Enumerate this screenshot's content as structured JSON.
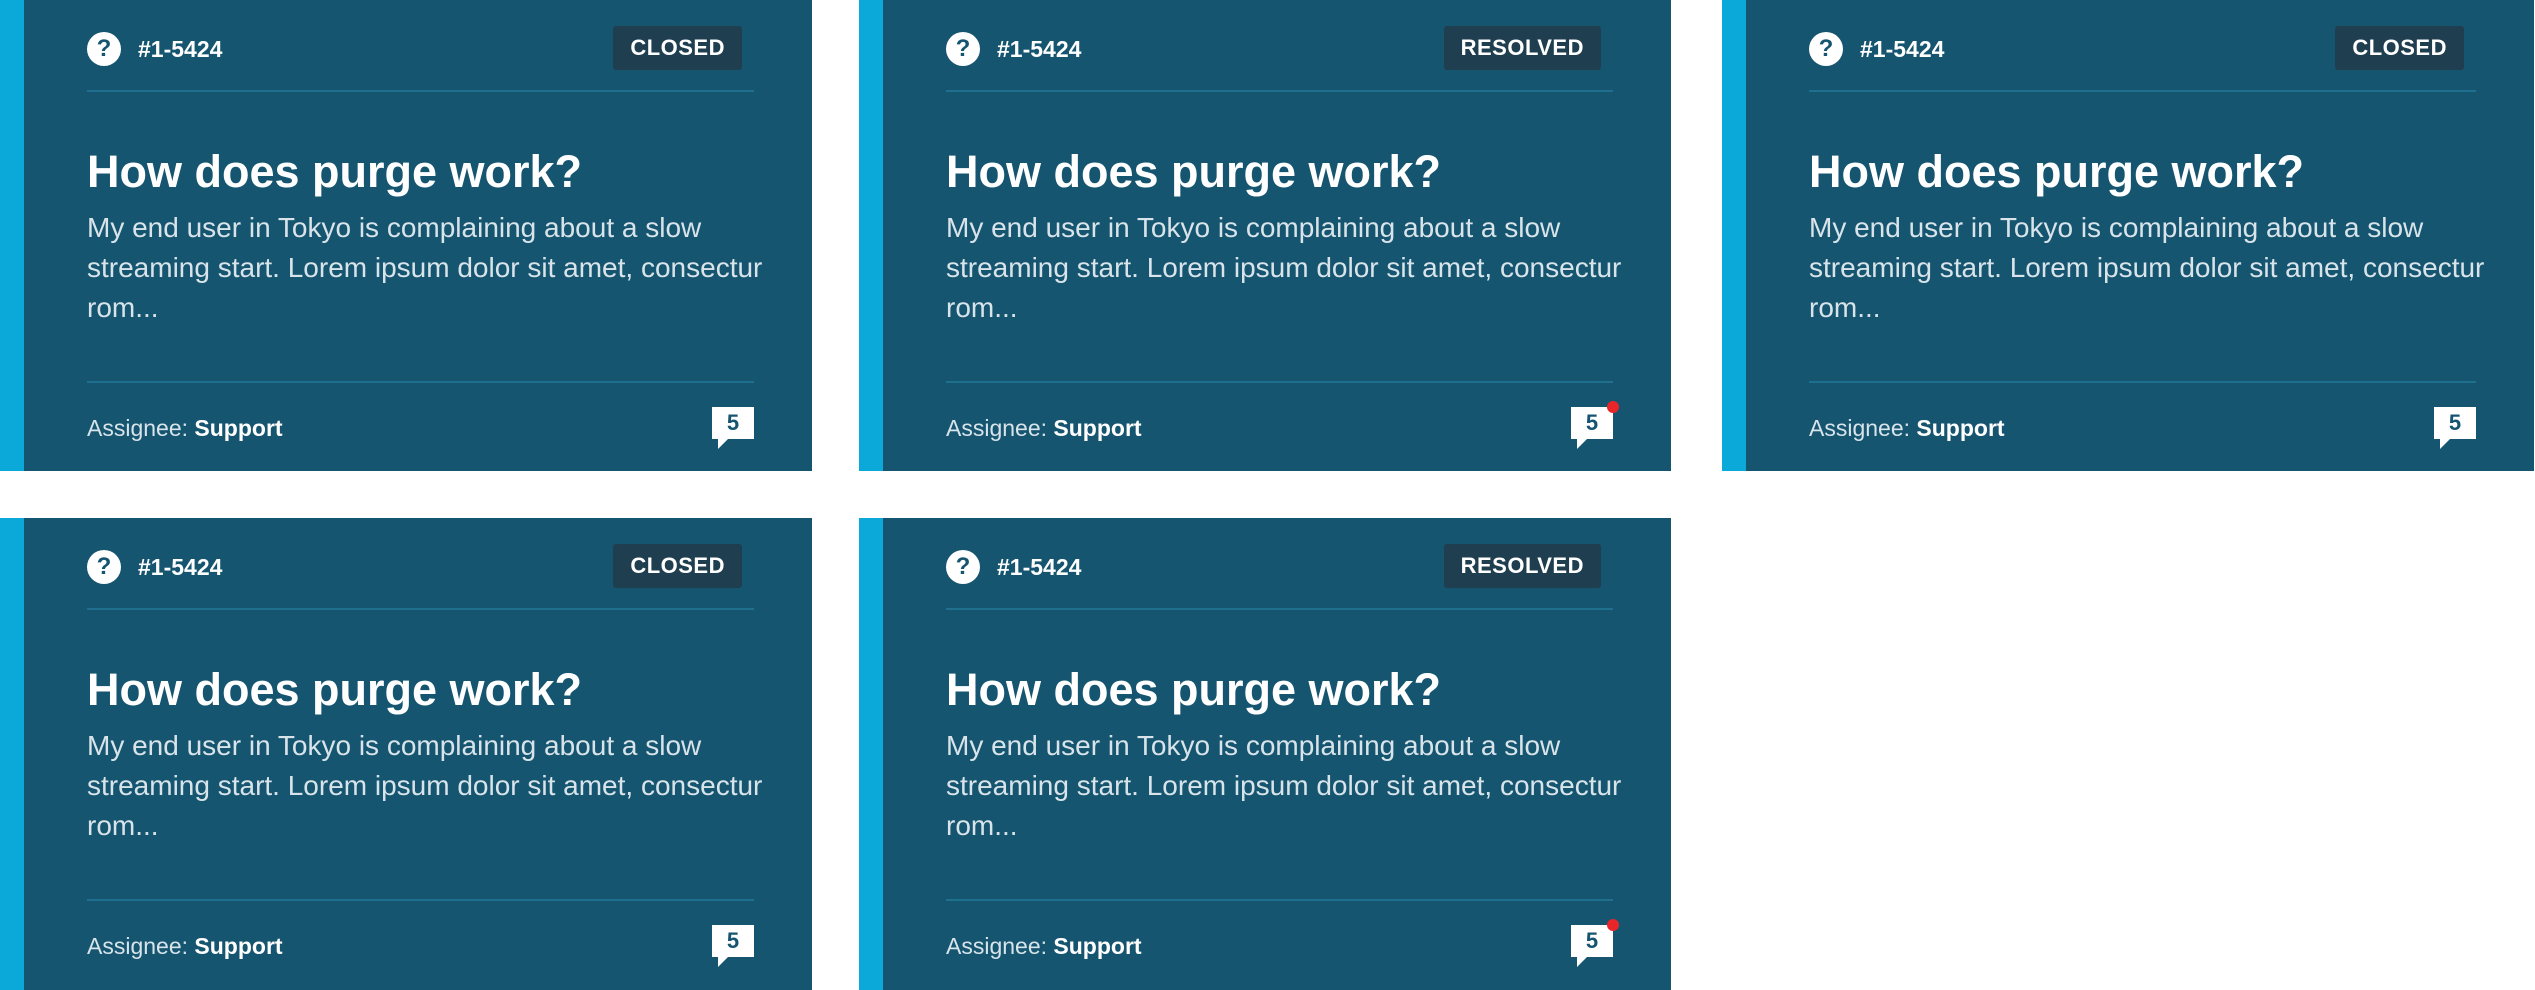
{
  "cards": [
    {
      "ticket_id": "#1-5424",
      "status": "CLOSED",
      "title": "How does purge work?",
      "description": "My end user in Tokyo is complaining about a slow streaming start. Lorem ipsum dolor sit amet, consectur rom...",
      "assignee_label": "Assignee:",
      "assignee": "Support",
      "comment_count": "5",
      "has_unread": false
    },
    {
      "ticket_id": "#1-5424",
      "status": "RESOLVED",
      "title": "How does purge work?",
      "description": "My end user in Tokyo is complaining about a slow streaming start. Lorem ipsum dolor sit amet, consectur rom...",
      "assignee_label": "Assignee:",
      "assignee": "Support",
      "comment_count": "5",
      "has_unread": true
    },
    {
      "ticket_id": "#1-5424",
      "status": "CLOSED",
      "title": "How does purge work?",
      "description": "My end user in Tokyo is complaining about a slow streaming start. Lorem ipsum dolor sit amet, consectur rom...",
      "assignee_label": "Assignee:",
      "assignee": "Support",
      "comment_count": "5",
      "has_unread": false
    },
    {
      "ticket_id": "#1-5424",
      "status": "CLOSED",
      "title": "How does purge work?",
      "description": "My end user in Tokyo is complaining about a slow streaming start. Lorem ipsum dolor sit amet, consectur rom...",
      "assignee_label": "Assignee:",
      "assignee": "Support",
      "comment_count": "5",
      "has_unread": false
    },
    {
      "ticket_id": "#1-5424",
      "status": "RESOLVED",
      "title": "How does purge work?",
      "description": "My end user in Tokyo is complaining about a slow streaming start. Lorem ipsum dolor sit amet, consectur rom...",
      "assignee_label": "Assignee:",
      "assignee": "Support",
      "comment_count": "5",
      "has_unread": true
    }
  ],
  "colors": {
    "card_background": "#155570",
    "accent_bar": "#0aa9da",
    "status_badge": "#1f3e4f",
    "unread_dot": "#e8262a"
  },
  "icons": {
    "ticket_icon": "question-circle-icon",
    "comment_icon": "comment-bubble-icon"
  }
}
